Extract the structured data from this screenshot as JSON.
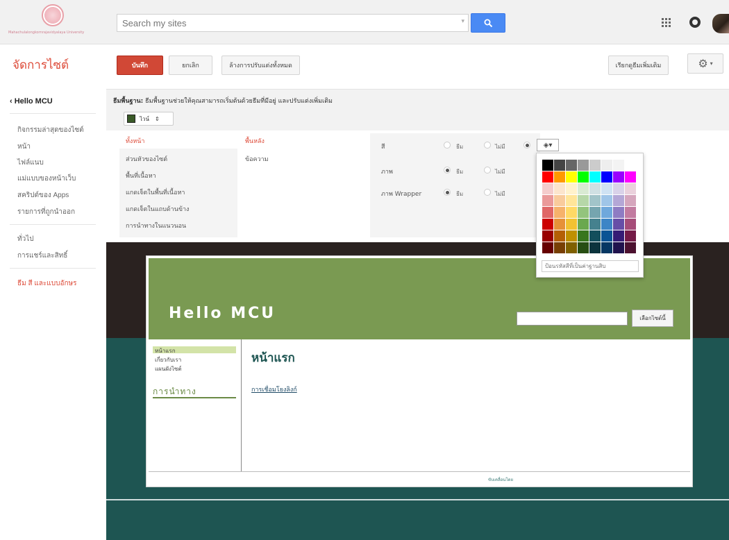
{
  "topbar": {
    "logo_text": "Mahachulalongkornrajavidyalaya University",
    "search_placeholder": "Search my sites",
    "search_dropdown": "▾"
  },
  "header": {
    "title": "จัดการไซต์",
    "save_label": "บันทึก",
    "cancel_label": "ยกเลิก",
    "reset_label": "ล้างการปรับแต่งทั้งหมด",
    "browse_label": "เรียกดูธีมเพิ่มเติม",
    "gear_caret": "▾"
  },
  "sidebar": {
    "back_label": "‹ Hello MCU",
    "items": [
      "กิจกรรมล่าสุดของไซต์",
      "หน้า",
      "ไฟล์แนบ",
      "แม่แบบของหน้าเว็บ",
      "สคริปต์ของ Apps",
      "รายการที่ถูกนำออก",
      "ทั่วไป",
      "การแชร์และสิทธิ์",
      "ธีม สี และแบบอักษร"
    ]
  },
  "themes": {
    "label_bold": "ธีมพื้นฐาน:",
    "label_text": "ธีมพื้นฐานช่วยให้คุณสามารถเริ่มต้นด้วยธีมที่มีอยู่ และปรับแต่งเพิ่มเติม",
    "selected": "ไวน์",
    "select_caret": "⇕",
    "swatch_color": "#3a5a28"
  },
  "customizer": {
    "elements_header": "ทั้งหน้า",
    "elements": [
      "ส่วนหัวของไซต์",
      "พื้นที่เนื้อหา",
      "แกดเจ็ตในพื้นที่เนื้อหา",
      "แกดเจ็ตในแถบด้านข้าง",
      "การนำทางในแนวนอน"
    ],
    "props_header": "พื้นหลัง",
    "props": [
      "ข้อความ"
    ],
    "rows": [
      {
        "label": "สี",
        "opt1": "ธีม",
        "opt2": "ไม่มี"
      },
      {
        "label": "ภาพ",
        "opt1": "ธีม",
        "opt2": "ไม่มี"
      },
      {
        "label": "ภาพ Wrapper",
        "opt1": "ธีม",
        "opt2": "ไม่มี"
      }
    ],
    "picker_icon": "◈▾"
  },
  "palette": {
    "colors": [
      "#000000",
      "#444444",
      "#666666",
      "#999999",
      "#cccccc",
      "#eeeeee",
      "#f3f3f3",
      "#ffffff",
      "#ff0000",
      "#ff9900",
      "#ffff00",
      "#00ff00",
      "#00ffff",
      "#0000ff",
      "#9900ff",
      "#ff00ff",
      "#f4cccc",
      "#fce5cd",
      "#fff2cc",
      "#d9ead3",
      "#d0e0e3",
      "#cfe2f3",
      "#d9d2e9",
      "#ead1dc",
      "#ea9999",
      "#f9cb9c",
      "#ffe599",
      "#b6d7a8",
      "#a2c4c9",
      "#9fc5e8",
      "#b4a7d6",
      "#d5a6bd",
      "#e06666",
      "#f6b26b",
      "#ffd966",
      "#93c47d",
      "#76a5af",
      "#6fa8dc",
      "#8e7cc3",
      "#c27ba0",
      "#cc0000",
      "#e69138",
      "#f1c232",
      "#6aa84f",
      "#45818e",
      "#3d85c6",
      "#674ea7",
      "#a64d79",
      "#990000",
      "#b45f06",
      "#bf9000",
      "#38761d",
      "#134f5c",
      "#0b5394",
      "#351c75",
      "#741b47",
      "#660000",
      "#783f04",
      "#7f6000",
      "#274e13",
      "#0c343d",
      "#073763",
      "#20124d",
      "#4c1130"
    ],
    "hex_placeholder": "ป้อนรหัสสีที่เป็นค่าฐานสิบ"
  },
  "preview": {
    "site_title": "Hello MCU",
    "search_btn": "เลือกไซต์นี้",
    "nav_items": [
      "หน้าแรก",
      "เกี่ยวกับเรา",
      "แผนผังไซต์"
    ],
    "nav_heading": "การนำทาง",
    "main_title": "หน้าแรก",
    "main_link": "การเชื่อมโยงลิงก์",
    "footer_text": "ขับเคลื่อนโดย",
    "colors": {
      "header": "#7a9a52",
      "background_top": "#2a2220",
      "background_bottom": "#1e5552",
      "accent": "#d14836"
    }
  }
}
